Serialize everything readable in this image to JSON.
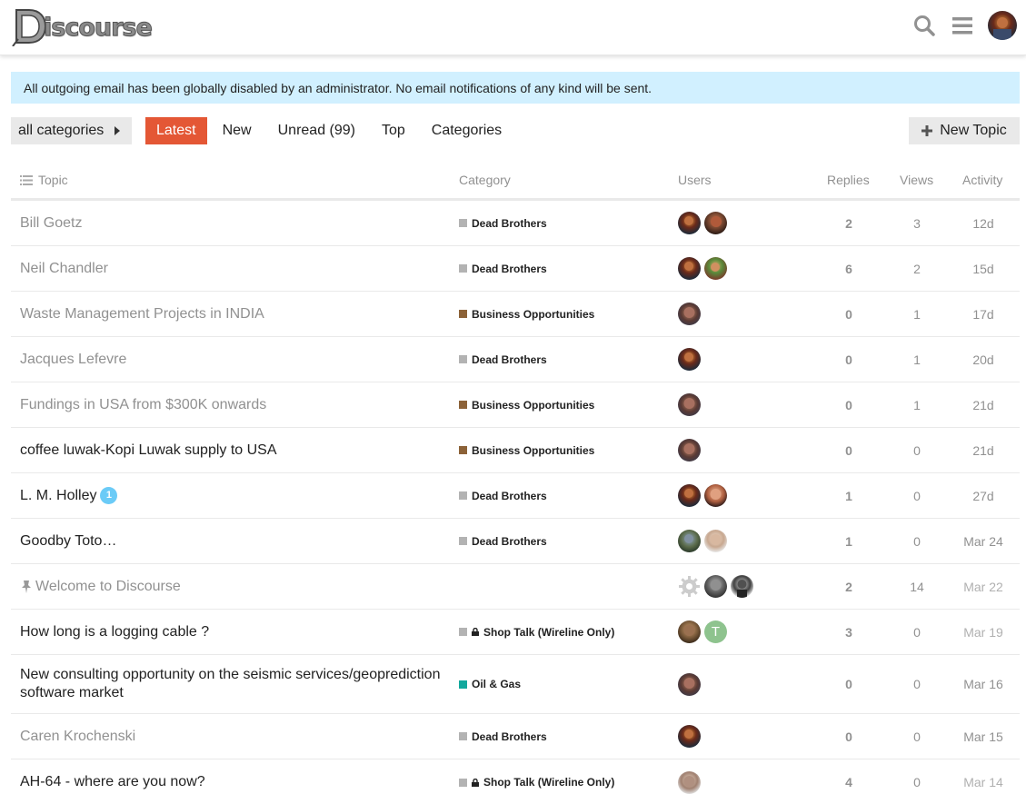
{
  "header": {
    "logo_text": "iscourse"
  },
  "banner": {
    "text": "All outgoing email has been globally disabled by an administrator. No email notifications of any kind will be sent."
  },
  "nav": {
    "category_dropdown": "all categories",
    "tabs": [
      {
        "label": "Latest",
        "active": true
      },
      {
        "label": "New",
        "active": false
      },
      {
        "label": "Unread (99)",
        "active": false
      },
      {
        "label": "Top",
        "active": false
      },
      {
        "label": "Categories",
        "active": false
      }
    ],
    "new_topic": "New Topic"
  },
  "table": {
    "columns": {
      "topic": "Topic",
      "category": "Category",
      "users": "Users",
      "replies": "Replies",
      "views": "Views",
      "activity": "Activity"
    },
    "rows": [
      {
        "title": "Bill Goetz",
        "category": "Dead Brothers",
        "replies": "2",
        "views": "3",
        "activity": "12d"
      },
      {
        "title": "Neil Chandler",
        "category": "Dead Brothers",
        "replies": "6",
        "views": "2",
        "activity": "15d"
      },
      {
        "title": "Waste Management Projects in INDIA",
        "category": "Business Opportunities",
        "replies": "0",
        "views": "1",
        "activity": "17d"
      },
      {
        "title": "Jacques Lefevre",
        "category": "Dead Brothers",
        "replies": "0",
        "views": "1",
        "activity": "20d"
      },
      {
        "title": "Fundings in USA from $300K onwards",
        "category": "Business Opportunities",
        "replies": "0",
        "views": "1",
        "activity": "21d"
      },
      {
        "title": "coffee luwak-Kopi Luwak supply to USA",
        "category": "Business Opportunities",
        "replies": "0",
        "views": "0",
        "activity": "21d"
      },
      {
        "title": "L. M. Holley",
        "new_posts": "1",
        "category": "Dead Brothers",
        "replies": "1",
        "views": "0",
        "activity": "27d"
      },
      {
        "title": "Goodby Toto…",
        "category": "Dead Brothers",
        "replies": "1",
        "views": "0",
        "activity": "Mar 24"
      },
      {
        "title": "Welcome to Discourse",
        "category": "",
        "replies": "2",
        "views": "14",
        "activity": "Mar 22"
      },
      {
        "title": "How long is a logging cable ?",
        "category": "Shop Talk (Wireline Only)",
        "replies": "3",
        "views": "0",
        "activity": "Mar 19"
      },
      {
        "title": "New consulting opportunity on the seismic services/geoprediction software market",
        "category": "Oil & Gas",
        "replies": "0",
        "views": "0",
        "activity": "Mar 16"
      },
      {
        "title": "Caren Krochenski",
        "category": "Dead Brothers",
        "replies": "0",
        "views": "0",
        "activity": "Mar 15"
      },
      {
        "title": "AH-64 - where are you now?",
        "category": "Shop Talk (Wireline Only)",
        "replies": "4",
        "views": "0",
        "activity": "Mar 14"
      }
    ],
    "avatar_letter": "T"
  },
  "colors": {
    "accent": "#e45735",
    "banner_bg": "#d1f0ff",
    "dead_brothers": "#b3b3b3",
    "business_opportunities": "#8c6238",
    "oil_gas": "#12a89d",
    "shop_talk": "#b3b3b3",
    "new_badge": "#6bcbf7"
  }
}
